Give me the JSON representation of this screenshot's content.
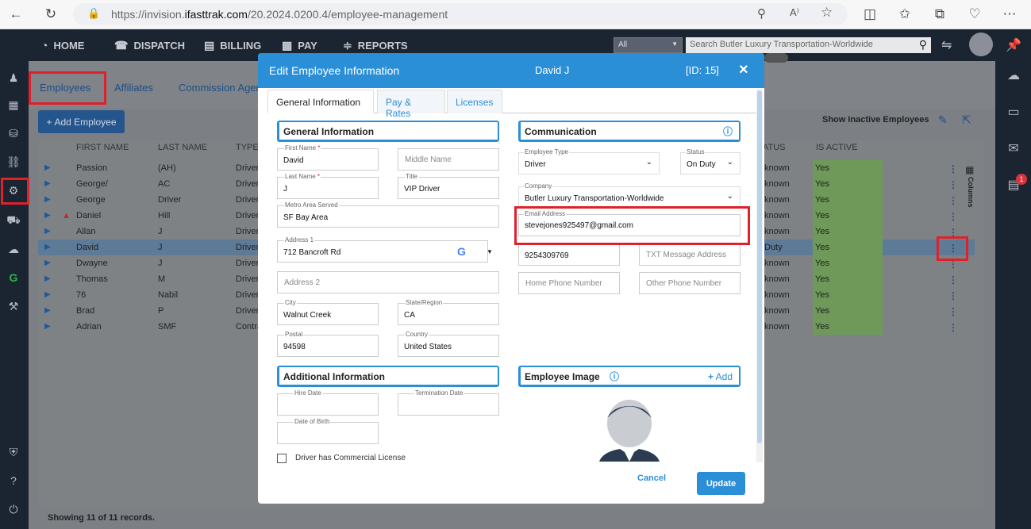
{
  "browser": {
    "url_prefix": "https://invision.",
    "url_domain": "ifasttrak.com",
    "url_path": "/20.2024.0200.4/employee-management"
  },
  "topnav": {
    "items": [
      {
        "label": "HOME",
        "icon": "dashboard-icon"
      },
      {
        "label": "DISPATCH",
        "icon": "headset-icon"
      },
      {
        "label": "BILLING",
        "icon": "document-icon"
      },
      {
        "label": "PAY",
        "icon": "money-icon"
      },
      {
        "label": "REPORTS",
        "icon": "chart-icon"
      }
    ],
    "search_scope": "All",
    "search_placeholder": "Search Butler Luxury Transportation-Worldwide"
  },
  "main": {
    "tabs": [
      "Employees",
      "Affiliates",
      "Commission Agen"
    ],
    "add_button": "Add Employee",
    "show_inactive": "Show Inactive Employees",
    "columns_label": "Columns",
    "headers": {
      "first": "FIRST NAME",
      "last": "LAST NAME",
      "type": "TYPE",
      "status": "ATUS",
      "active": "IS ACTIVE"
    },
    "rows": [
      {
        "first": "Passion",
        "last": "(AH)",
        "type": "Driver",
        "status": "known",
        "active": "Yes",
        "warn": false
      },
      {
        "first": "George/",
        "last": "AC",
        "type": "Driver",
        "status": "known",
        "active": "Yes",
        "warn": false
      },
      {
        "first": "George",
        "last": "Driver",
        "type": "Driver",
        "status": "known",
        "active": "Yes",
        "warn": false
      },
      {
        "first": "Daniel",
        "last": "Hill",
        "type": "Driver",
        "status": "known",
        "active": "Yes",
        "warn": true
      },
      {
        "first": "Allan",
        "last": "J",
        "type": "Driver",
        "status": "known",
        "active": "Yes",
        "warn": false
      },
      {
        "first": "David",
        "last": "J",
        "type": "Driver",
        "status": "Duty",
        "active": "Yes",
        "warn": false
      },
      {
        "first": "Dwayne",
        "last": "J",
        "type": "Driver",
        "status": "known",
        "active": "Yes",
        "warn": false
      },
      {
        "first": "Thomas",
        "last": "M",
        "type": "Driver",
        "status": "known",
        "active": "Yes",
        "warn": false
      },
      {
        "first": "76",
        "last": "Nabil",
        "type": "Driver",
        "status": "known",
        "active": "Yes",
        "warn": false
      },
      {
        "first": "Brad",
        "last": "P",
        "type": "Driver",
        "status": "known",
        "active": "Yes",
        "warn": false
      },
      {
        "first": "Adrian",
        "last": "SMF",
        "type": "Contra",
        "status": "known",
        "active": "Yes",
        "warn": false
      }
    ],
    "footer": "Showing 11 of 11 records."
  },
  "rightbar": {
    "notification_count": "1"
  },
  "modal": {
    "title": "Edit Employee Information",
    "employee_name": "David J",
    "employee_id": "[ID: 15]",
    "close": "×",
    "tabs": [
      "General Information",
      "Pay & Rates",
      "Licenses"
    ],
    "general": {
      "section_title": "General Information",
      "first_name_label": "First Name",
      "first_name": "David",
      "middle_name_placeholder": "Middle Name",
      "last_name_label": "Last Name",
      "last_name": "J",
      "title_label": "Title",
      "title": "VIP Driver",
      "metro_label": "Metro Area Served",
      "metro": "SF Bay Area",
      "address1_label": "Address 1",
      "address1": "712 Bancroft Rd",
      "address2_placeholder": "Address 2",
      "city_label": "City",
      "city": "Walnut Creek",
      "state_label": "State/Region",
      "state": "CA",
      "postal_label": "Postal",
      "postal": "94598",
      "country_label": "Country",
      "country": "United States"
    },
    "additional": {
      "section_title": "Additional Information",
      "hire_label": "Hire Date",
      "termination_label": "Termination Date",
      "dob_label": "Date of Birth",
      "cdl_label": "Driver has Commercial License"
    },
    "communication": {
      "section_title": "Communication",
      "type_label": "Employee Type",
      "type": "Driver",
      "status_label": "Status",
      "status": "On Duty",
      "company_label": "Company",
      "company": "Butler Luxury Transportation-Worldwide",
      "email_label": "Email Address",
      "email": "stevejones925497@gmail.com",
      "phone": "9254309769",
      "txt_placeholder": "TXT Message Address",
      "home_placeholder": "Home Phone Number",
      "other_placeholder": "Other Phone Number"
    },
    "image": {
      "section_title": "Employee Image",
      "add_label": "Add"
    },
    "cancel": "Cancel",
    "update": "Update"
  }
}
